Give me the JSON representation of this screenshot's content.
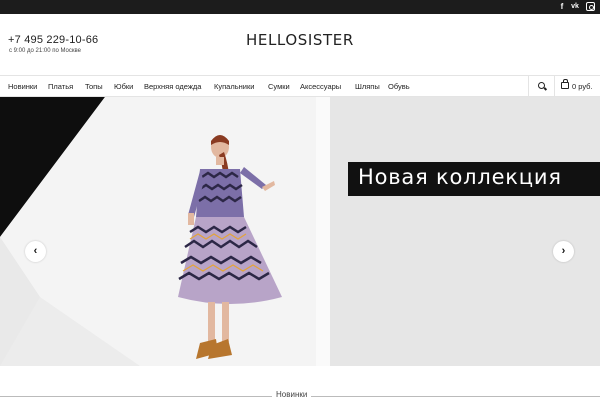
{
  "topbar": {
    "social": [
      {
        "icon": "facebook-icon",
        "glyph": "f"
      },
      {
        "icon": "vk-icon",
        "glyph": "vk"
      },
      {
        "icon": "instagram-icon",
        "glyph": ""
      }
    ]
  },
  "header": {
    "phone": "+7 495 229-10-66",
    "hours": "с 9:00 до 21:00 по Москве",
    "logo": "HELLOSISTER"
  },
  "nav": {
    "items": [
      {
        "label": "Новинки"
      },
      {
        "label": "Платья"
      },
      {
        "label": "Топы"
      },
      {
        "label": "Юбки"
      },
      {
        "label": "Верхняя одежда"
      },
      {
        "label": "Купальники"
      },
      {
        "label": "Сумки"
      },
      {
        "label": "Аксессуары"
      },
      {
        "label": "Шляпы"
      },
      {
        "label": "Обувь"
      }
    ],
    "search_icon": "search-icon",
    "cart_icon": "shopping-bag-icon",
    "cart_total": "0 руб."
  },
  "hero": {
    "banner_text": "Новая коллекция",
    "prev_icon": "chevron-left-icon",
    "prev_glyph": "‹",
    "next_icon": "chevron-right-icon",
    "next_glyph": "›"
  },
  "section": {
    "title": "Новинки"
  },
  "colors": {
    "topbar": "#1c1c1c",
    "banner": "#111111",
    "text": "#222222"
  }
}
